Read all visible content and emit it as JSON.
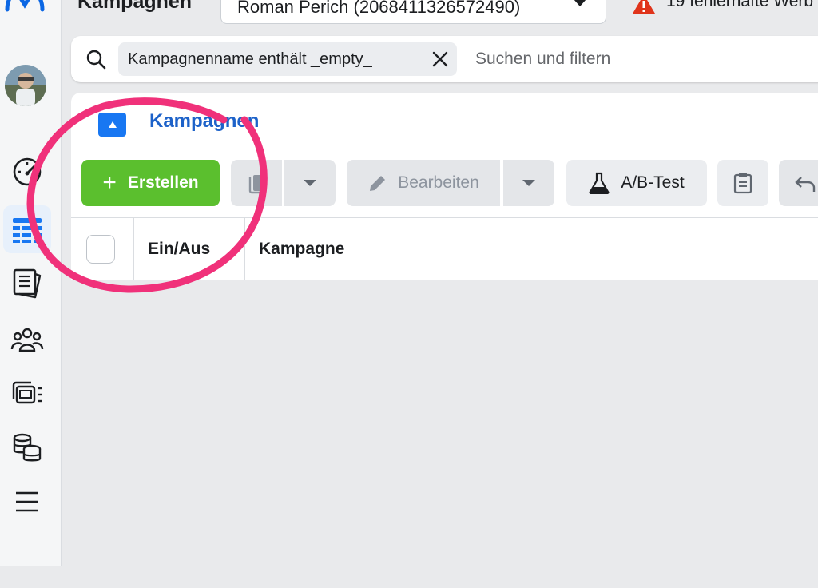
{
  "header": {
    "title": "Kampagnen",
    "account_selector": "Roman Perich (2068411326572490)",
    "warning_text": "19 fehlerhafte Werb"
  },
  "search": {
    "filter_chip": "Kampagnenname enthält _empty_",
    "placeholder": "Suchen und filtern"
  },
  "tabs": [
    {
      "label": "Kampagnen"
    }
  ],
  "toolbar": {
    "create_label": "Erstellen",
    "edit_label": "Bearbeiten",
    "ab_test_label": "A/B-Test"
  },
  "table": {
    "columns": [
      "Ein/Aus",
      "Kampagne"
    ]
  },
  "sidebar": {
    "icons": [
      "meta-logo",
      "avatar",
      "dashboard-gauge-icon",
      "campaigns-table-icon",
      "pages-icon",
      "audiences-icon",
      "ads-manager-icon",
      "billing-icon",
      "menu-icon"
    ]
  },
  "colors": {
    "accent": "#1877f2",
    "create_button": "#5bbf2e",
    "annotation": "#f0317a",
    "tab_text": "#1d62c9"
  }
}
